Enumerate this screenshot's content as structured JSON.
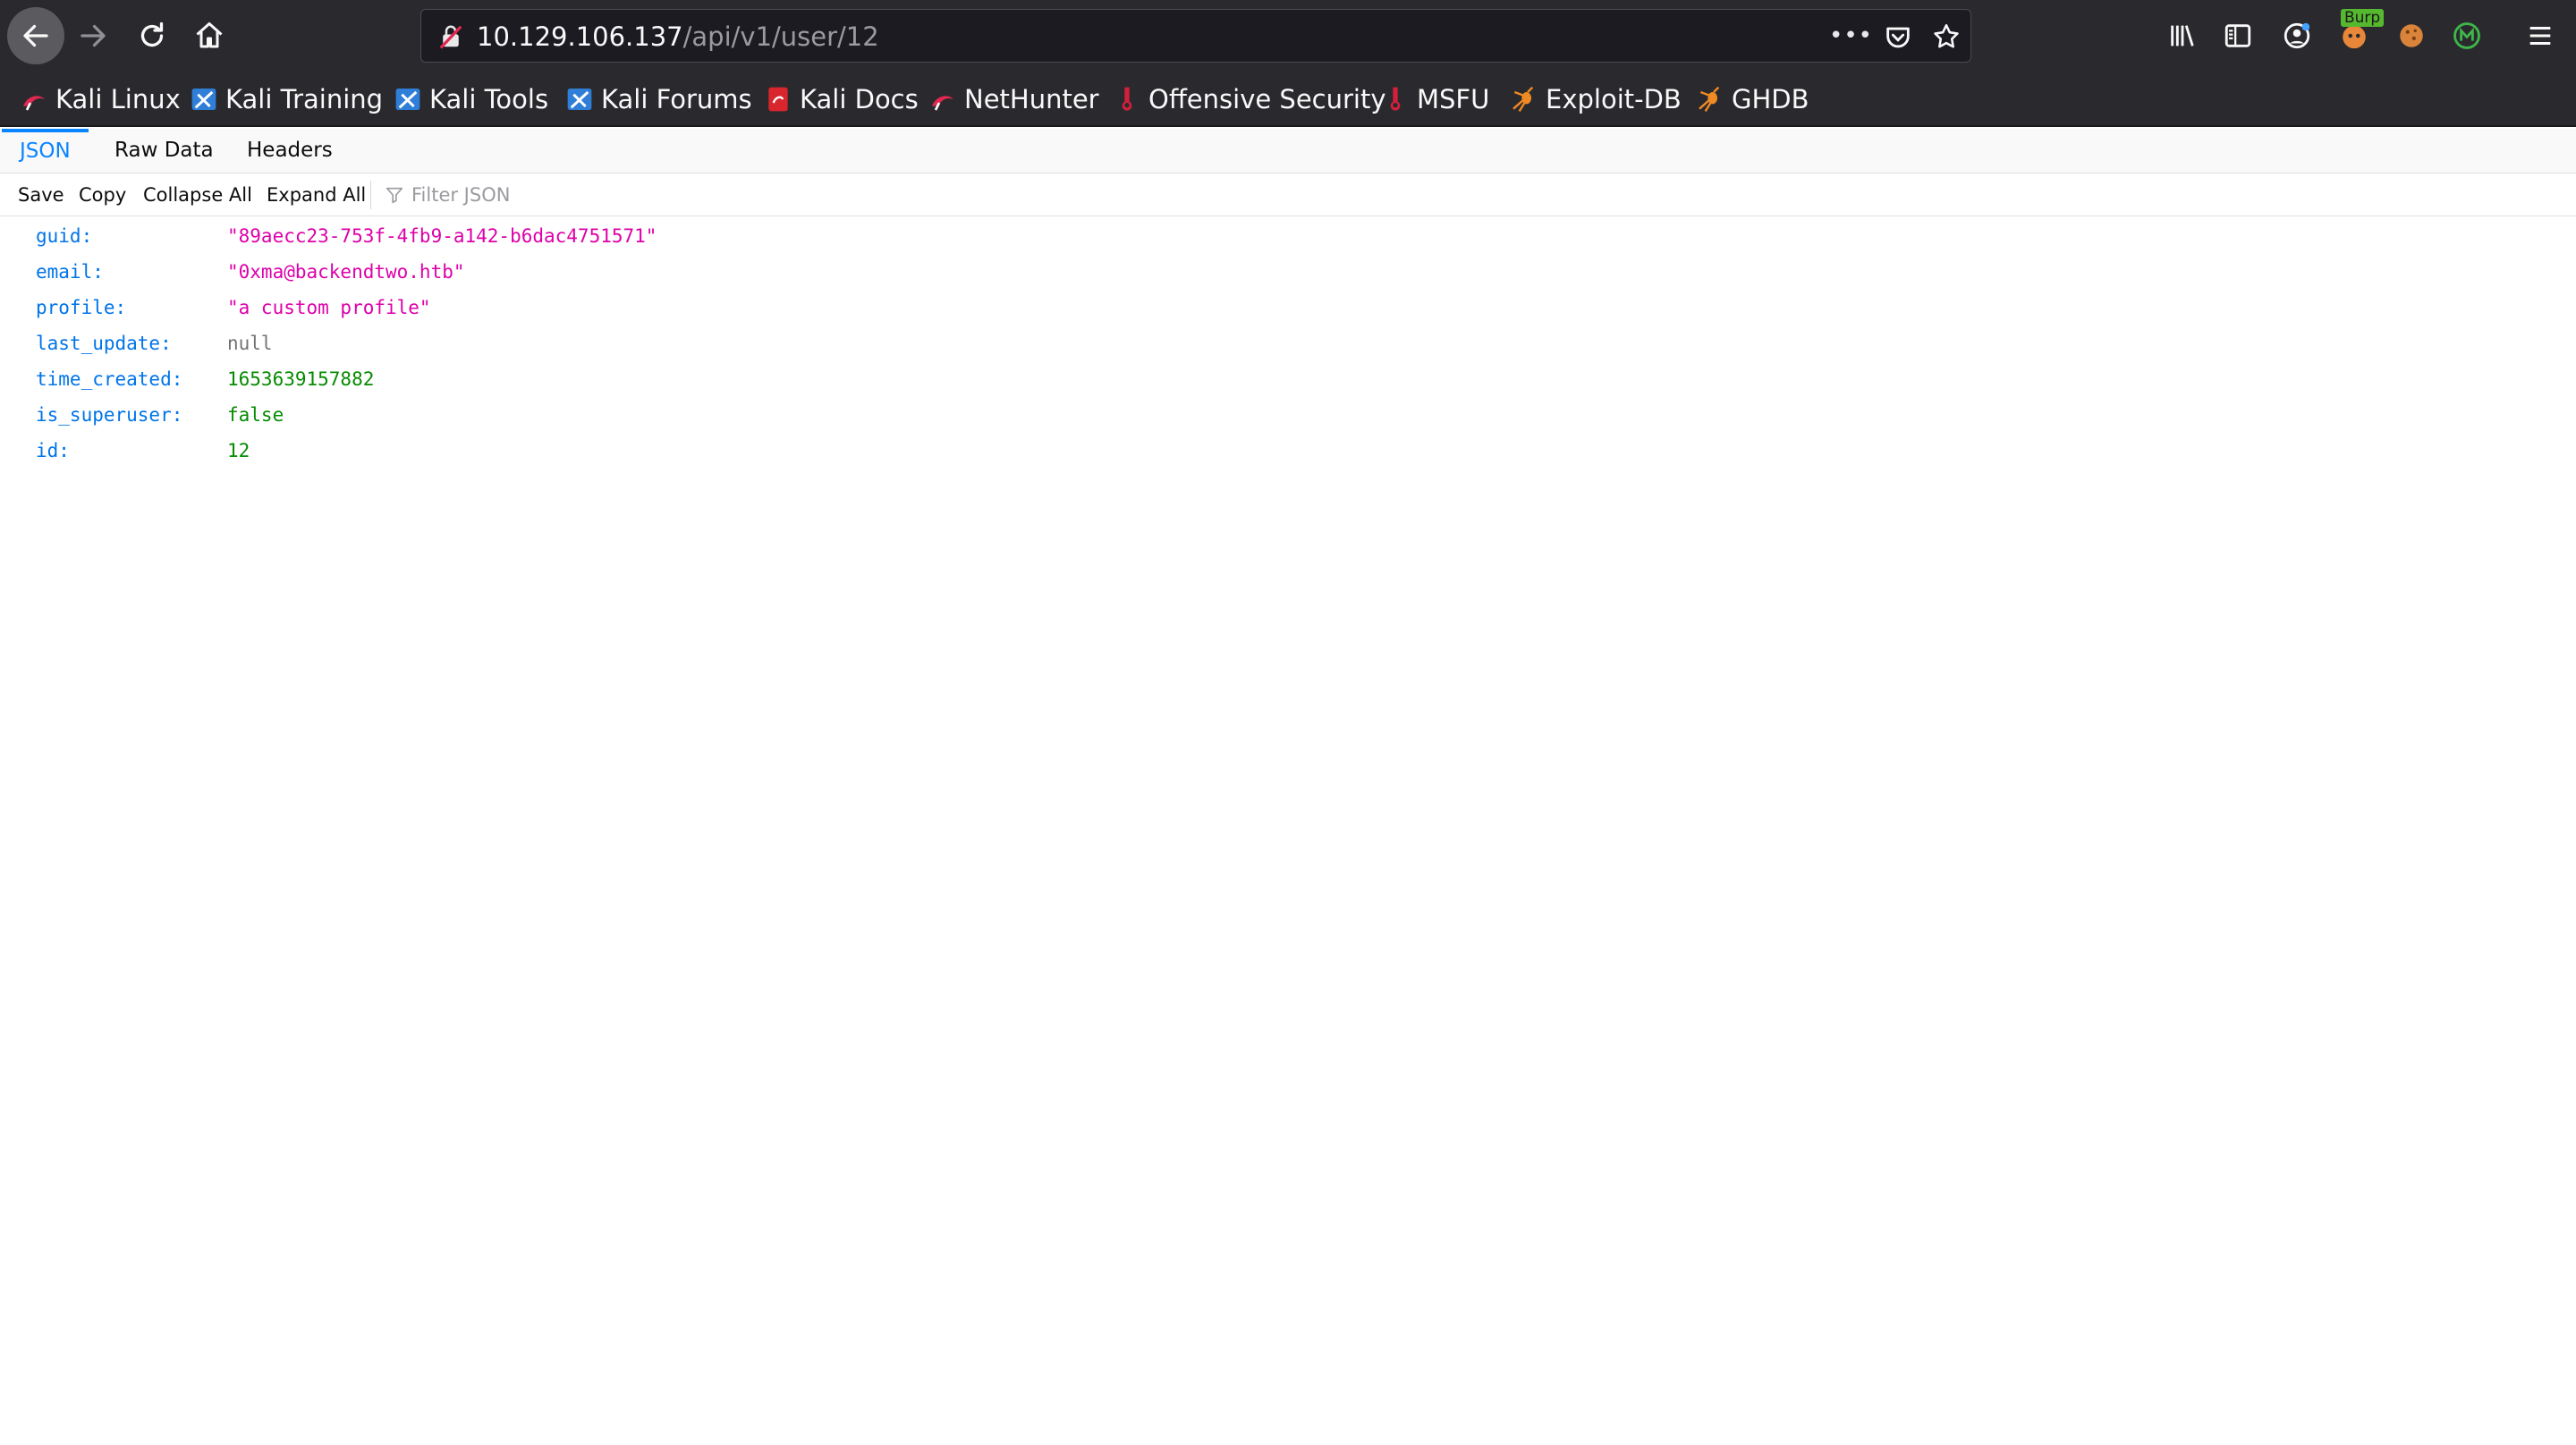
{
  "browser": {
    "url_host": "10.129.106.137",
    "url_path": "/api/v1/user/12",
    "url_more": "•••",
    "burp_badge": "Burp"
  },
  "bookmarks": [
    {
      "label": "Kali Linux",
      "icon": "kali-dragon-icon"
    },
    {
      "label": "Kali Training",
      "icon": "kali-blue-icon"
    },
    {
      "label": "Kali Tools",
      "icon": "kali-blue-icon"
    },
    {
      "label": "Kali Forums",
      "icon": "kali-blue-icon"
    },
    {
      "label": "Kali Docs",
      "icon": "kali-red-icon"
    },
    {
      "label": "NetHunter",
      "icon": "kali-dragon-icon"
    },
    {
      "label": "Offensive Security",
      "icon": "offsec-icon"
    },
    {
      "label": "MSFU",
      "icon": "offsec-icon"
    },
    {
      "label": "Exploit-DB",
      "icon": "spider-icon"
    },
    {
      "label": "GHDB",
      "icon": "spider-icon"
    }
  ],
  "viewer": {
    "tabs": [
      "JSON",
      "Raw Data",
      "Headers"
    ],
    "active_tab": "JSON",
    "toolbar": {
      "save": "Save",
      "copy": "Copy",
      "collapse_all": "Collapse All",
      "expand_all": "Expand All",
      "filter_placeholder": "Filter JSON"
    },
    "rows": [
      {
        "key": "guid:",
        "value": "\"89aecc23-753f-4fb9-a142-b6dac4751571\"",
        "type": "string"
      },
      {
        "key": "email:",
        "value": "\"0xma@backendtwo.htb\"",
        "type": "string"
      },
      {
        "key": "profile:",
        "value": "\"a custom profile\"",
        "type": "string"
      },
      {
        "key": "last_update:",
        "value": "null",
        "type": "null"
      },
      {
        "key": "time_created:",
        "value": "1653639157882",
        "type": "number"
      },
      {
        "key": "is_superuser:",
        "value": "false",
        "type": "bool"
      },
      {
        "key": "id:",
        "value": "12",
        "type": "number"
      }
    ]
  },
  "colors": {
    "chrome_bg": "#2a2a2e",
    "accent": "#0a84ff",
    "json_key": "#0074e8",
    "json_string": "#dd00a9",
    "json_number": "#058b00",
    "json_null": "#737373"
  }
}
